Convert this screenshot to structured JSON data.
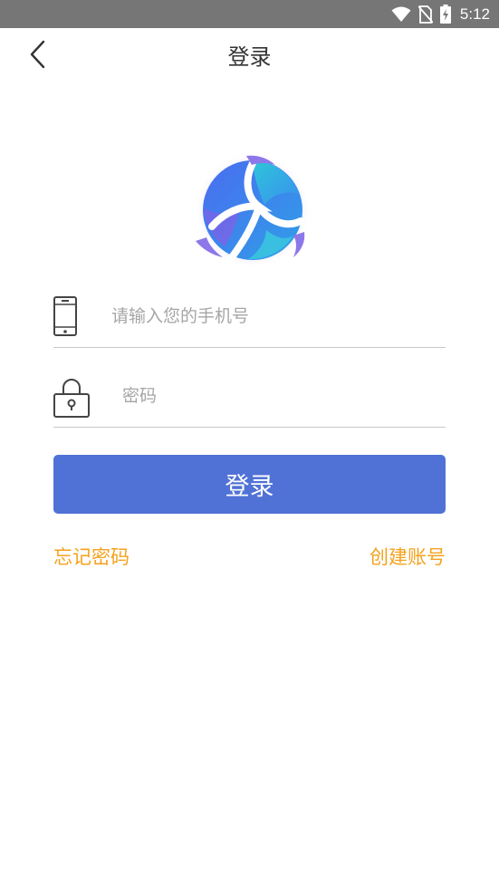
{
  "status_bar": {
    "time": "5:12",
    "icons": [
      "wifi-icon",
      "no-sim-icon",
      "battery-charging-icon"
    ]
  },
  "app_bar": {
    "title": "登录",
    "back_icon": "chevron-left-icon"
  },
  "form": {
    "phone": {
      "placeholder": "请输入您的手机号",
      "value": "",
      "icon": "mobile-phone-icon"
    },
    "password": {
      "placeholder": "密码",
      "value": "",
      "icon": "padlock-icon"
    },
    "login_button": "登录"
  },
  "links": {
    "forgot_password": "忘记密码",
    "create_account": "创建账号"
  },
  "colors": {
    "status_bar": "#767676",
    "primary": "#5072d6",
    "link": "#f4a21d",
    "divider": "#c8c8c8"
  }
}
